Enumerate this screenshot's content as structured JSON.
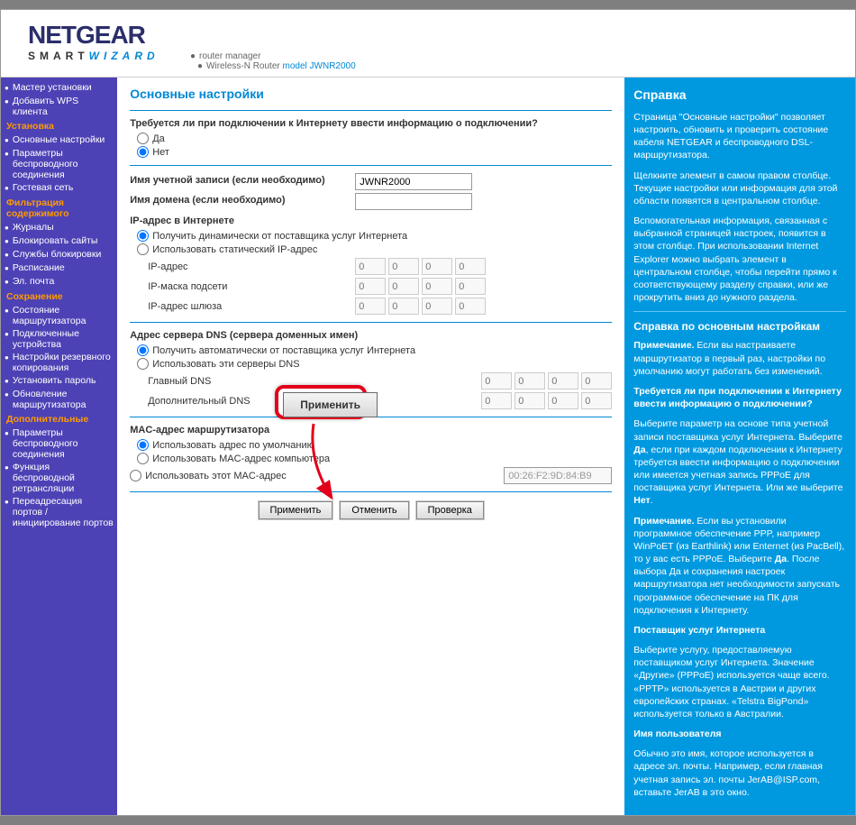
{
  "brand": {
    "name": "NETGEAR",
    "tag1": "SMART",
    "tag2": "WIZARD",
    "sub1": "router manager",
    "sub2a": "Wireless-N Router",
    "sub2b": "model JWNR2000"
  },
  "sidebar": {
    "top": [
      "Мастер установки",
      "Добавить WPS клиента"
    ],
    "g1": {
      "h": "Установка",
      "items": [
        "Основные настройки",
        "Параметры беспроводного соединения"
      ]
    },
    "g1b": {
      "h": "",
      "items": [
        "Гостевая сеть"
      ]
    },
    "g2": {
      "h": "Фильтрация содержимого",
      "items": [
        "Журналы",
        "Блокировать сайты",
        "Службы блокировки",
        "Расписание",
        "Эл. почта"
      ]
    },
    "g3": {
      "h": "Сохранение",
      "items": [
        "Состояние маршрутизатора",
        "Подключенные устройства",
        "Настройки резервного копирования",
        "Установить пароль",
        "Обновление маршрутизатора"
      ]
    },
    "g4": {
      "h": "Дополнительные",
      "items": [
        "Параметры беспроводного соединения",
        "Функция беспроводной ретрансляции",
        "Переадресация портов / инициирование портов"
      ]
    }
  },
  "main": {
    "title": "Основные настройки",
    "q1": "Требуется ли при подключении к Интернету ввести информацию о подключении?",
    "yes": "Да",
    "no": "Нет",
    "acct_lbl": "Имя учетной записи (если необходимо)",
    "acct_val": "JWNR2000",
    "domain_lbl": "Имя домена (если необходимо)",
    "domain_val": "",
    "ip_h": "IP-адрес в Интернете",
    "ip_auto": "Получить динамически от поставщика услуг Интернета",
    "ip_static": "Использовать статический IP-адрес",
    "ip_addr": "IP-адрес",
    "ip_mask": "IP-маска подсети",
    "ip_gw": "IP-адрес шлюза",
    "dns_h": "Адрес сервера DNS (сервера доменных имен)",
    "dns_auto": "Получить автоматически от поставщика услуг Интернета",
    "dns_use": "Использовать эти серверы DNS",
    "dns1": "Главный DNS",
    "dns2": "Дополнительный DNS",
    "mac_h": "MAC-адрес маршрутизатора",
    "mac_def": "Использовать адрес по умолчанию",
    "mac_pc": "Использовать MAC-адрес компьютера",
    "mac_this": "Использовать этот MAC-адрес",
    "mac_val": "00:26:F2:9D:84:B9",
    "apply": "Применить",
    "cancel": "Отменить",
    "test": "Проверка",
    "big_apply": "Применить",
    "ip_ph": "0"
  },
  "help": {
    "h1": "Справка",
    "p1": "Страница \"Основные настройки\" позволяет настроить, обновить и проверить состояние кабеля NETGEAR и беспроводного DSL-маршрутизатора.",
    "p2": "Щелкните элемент в самом правом столбце. Текущие настройки или информация для этой области появятся в центральном столбце.",
    "p3": "Вспомогательная информация, связанная с выбранной страницей настроек, появится в этом столбце. При использовании Internet Explorer можно выбрать элемент в центральном столбце, чтобы перейти прямо к соответствующему разделу справки, или же прокрутить вниз до нужного раздела.",
    "h2": "Справка по основным настройкам",
    "p4a": "Примечание.",
    "p4b": " Если вы настраиваете маршрутизатор в первый раз, настройки по умолчанию могут работать без изменений.",
    "p5": "Требуется ли при подключении к Интернету ввести информацию о подключении?",
    "p6a": "Выберите параметр на основе типа учетной записи поставщика услуг Интернета. Выберите ",
    "p6b": "Да",
    "p6c": ", если при каждом подключении к Интернету требуется ввести информацию о подключении или имеется учетная запись PPPoE для поставщика услуг Интернета. Или же выберите ",
    "p6d": "Нет",
    "p6e": ".",
    "p7a": "Примечание.",
    "p7b": " Если вы установили программное обеспечение PPP, например WinPoET (из Earthlink) или Enternet (из PacBell), то у вас есть PPPoE. Выберите ",
    "p7c": "Да",
    "p7d": ". После выбора Да и сохранения настроек маршрутизатора нет необходимости запускать программное обеспечение на ПК для подключения к Интернету.",
    "h3": "Поставщик услуг Интернета",
    "p8": "Выберите услугу, предоставляемую поставщиком услуг Интернета. Значение «Другие» (PPPoE) используется чаще всего. «PPTP» используется в Австрии и других европейских странах. «Telstra BigPond» используется только в Австралии.",
    "h4": "Имя пользователя",
    "p9": "Обычно это имя, которое используется в адресе эл. почты. Например, если главная учетная запись эл. почты JerAB@ISP.com, вставьте JerAB в это окно."
  }
}
